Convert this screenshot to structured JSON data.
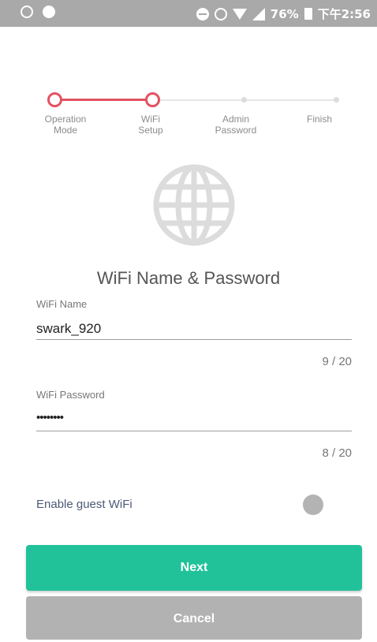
{
  "status_bar": {
    "battery": "76%",
    "time": "下午2:56"
  },
  "stepper": {
    "steps": [
      {
        "label": "Operation\nMode",
        "state": "completed"
      },
      {
        "label": "WiFi\nSetup",
        "state": "current"
      },
      {
        "label": "Admin\nPassword",
        "state": "pending"
      },
      {
        "label": "Finish",
        "state": "pending"
      }
    ],
    "accent_color": "#e25261"
  },
  "page": {
    "heading": "WiFi Name & Password"
  },
  "wifi_name": {
    "label": "WiFi Name",
    "value": "swark_920",
    "counter": "9 / 20"
  },
  "wifi_password": {
    "label": "WiFi Password",
    "value": "••••••••",
    "counter": "8 / 20"
  },
  "guest": {
    "label": "Enable guest WiFi",
    "enabled": false
  },
  "buttons": {
    "next": "Next",
    "cancel": "Cancel",
    "next_color": "#21c29a",
    "cancel_color": "#b2b2b2"
  },
  "icons": {
    "globe": "globe-icon"
  }
}
